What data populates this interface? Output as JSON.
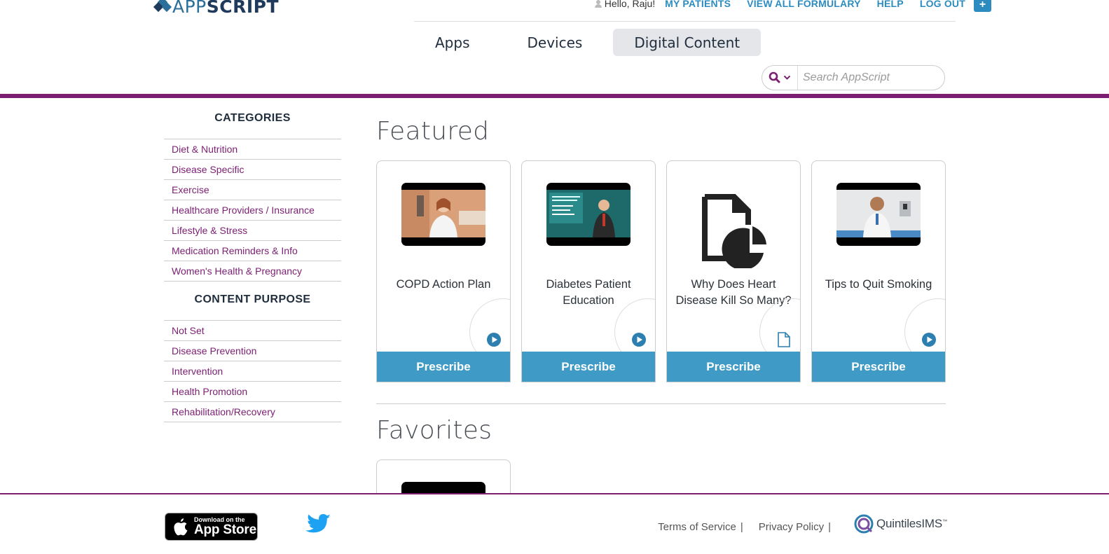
{
  "brand": {
    "logo_part1": "APP",
    "logo_part2": "SCRIPT"
  },
  "topnav": {
    "greeting": "Hello, Raju!",
    "links": [
      "MY PATIENTS",
      "VIEW ALL FORMULARY",
      "HELP",
      "LOG OUT"
    ],
    "plus": "+"
  },
  "tabs": [
    "Apps",
    "Devices",
    "Digital Content"
  ],
  "active_tab": "Digital Content",
  "search": {
    "placeholder": "Search AppScript"
  },
  "sidebar": {
    "categories_heading": "CATEGORIES",
    "categories": [
      "Diet & Nutrition",
      "Disease Specific",
      "Exercise",
      "Healthcare Providers / Insurance",
      "Lifestyle & Stress",
      "Medication Reminders & Info",
      "Women's Health & Pregnancy"
    ],
    "purpose_heading": "CONTENT PURPOSE",
    "purposes": [
      "Not Set",
      "Disease Prevention",
      "Intervention",
      "Health Promotion",
      "Rehabilitation/Recovery"
    ]
  },
  "featured": {
    "title": "Featured",
    "cards": [
      {
        "title": "COPD Action Plan",
        "content_type": "video-play-icon",
        "button": "Prescribe"
      },
      {
        "title": "Diabetes Patient Education",
        "content_type": "video-play-icon",
        "button": "Prescribe"
      },
      {
        "title": "Why Does Heart Disease Kill So Many?",
        "content_type": "document-icon",
        "button": "Prescribe"
      },
      {
        "title": "Tips to Quit Smoking",
        "content_type": "video-play-icon",
        "button": "Prescribe"
      }
    ]
  },
  "favorites": {
    "title": "Favorites"
  },
  "footer": {
    "appstore_small": "Download on the",
    "appstore_big": "App Store",
    "terms": "Terms of Service",
    "privacy": "Privacy Policy",
    "separator": "|",
    "partner": "QuintilesIMS",
    "partner_tm": "™"
  },
  "colors": {
    "purple": "#7b1f72",
    "blue": "#3f9bc6",
    "link_blue": "#2d8cbf",
    "navy": "#1f2d3d"
  }
}
